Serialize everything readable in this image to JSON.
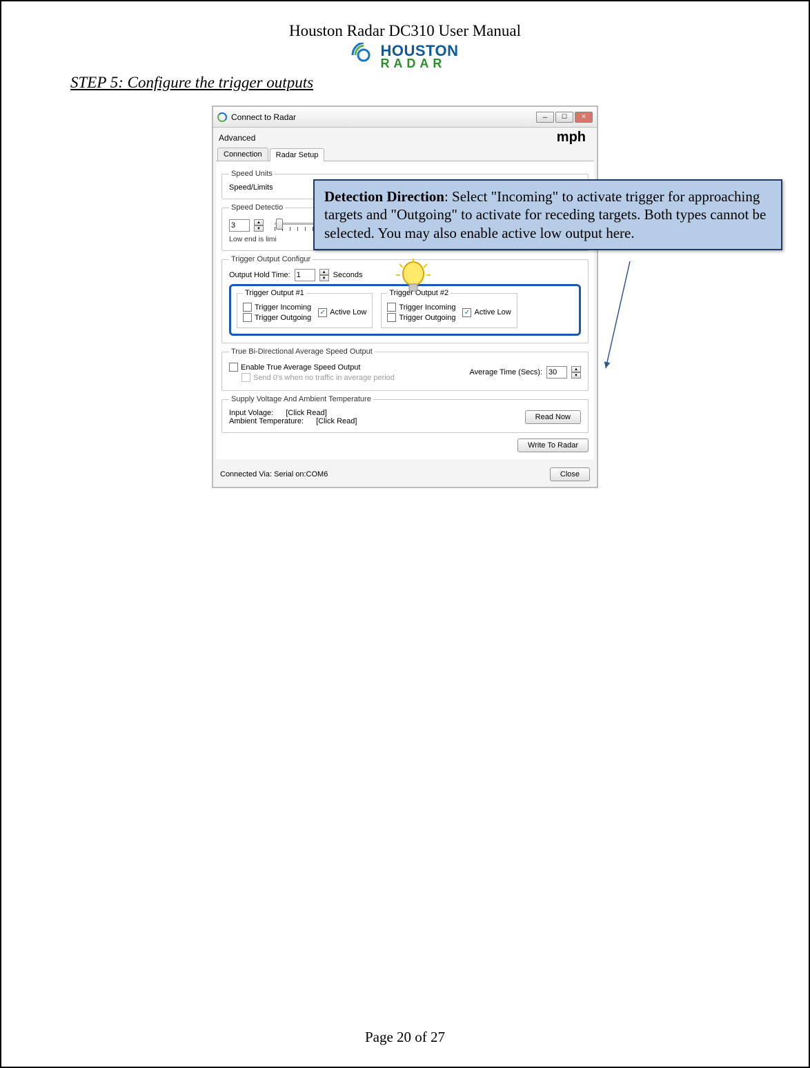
{
  "doc_title": "Houston Radar DC310 User Manual",
  "logo": {
    "top": "HOUSTON",
    "bottom": "RADAR"
  },
  "step_heading": "STEP 5: Configure the trigger outputs",
  "page_number": "Page 20 of 27",
  "callout": {
    "bold": "Detection Direction",
    "rest": ": Select \"Incoming\" to activate trigger for approaching targets and \"Outgoing\" to activate for receding targets. Both types cannot be selected.  You may also enable active low output here."
  },
  "window": {
    "title": "Connect to Radar",
    "menu_advanced": "Advanced",
    "mph": "mph",
    "tabs": {
      "connection": "Connection",
      "radar_setup": "Radar Setup"
    },
    "groups": {
      "speed_units": {
        "legend": "Speed Units",
        "label": "Speed/Limits"
      },
      "speed_detection": {
        "legend": "Speed Detectio",
        "value": "3",
        "caption": "Low end is limi"
      },
      "trigger_config": {
        "legend": "Trigger Output Configur",
        "hold_label": "Output Hold Time:",
        "hold_value": "1",
        "hold_unit": "Seconds",
        "out1": {
          "legend": "Trigger Output #1",
          "incoming": "Trigger Incoming",
          "outgoing": "Trigger Outgoing",
          "active_low": "Active Low"
        },
        "out2": {
          "legend": "Trigger Output #2",
          "incoming": "Trigger Incoming",
          "outgoing": "Trigger Outgoing",
          "active_low": "Active Low"
        }
      },
      "bidir": {
        "legend": "True Bi-Directional Average Speed Output",
        "enable": "Enable True Average Speed Output",
        "send0": "Send 0's when no traffic in average period",
        "avg_label": "Average Time (Secs):",
        "avg_value": "30"
      },
      "supply": {
        "legend": "Supply Voltage And Ambient Temperature",
        "iv_label": "Input Volage:",
        "iv_value": "[Click Read]",
        "at_label": "Ambient Temperature:",
        "at_value": "[Click Read]",
        "read_btn": "Read Now"
      }
    },
    "write_btn": "Write To  Radar",
    "connected_label": "Connected Via:   Serial on:COM6",
    "close_btn": "Close"
  }
}
